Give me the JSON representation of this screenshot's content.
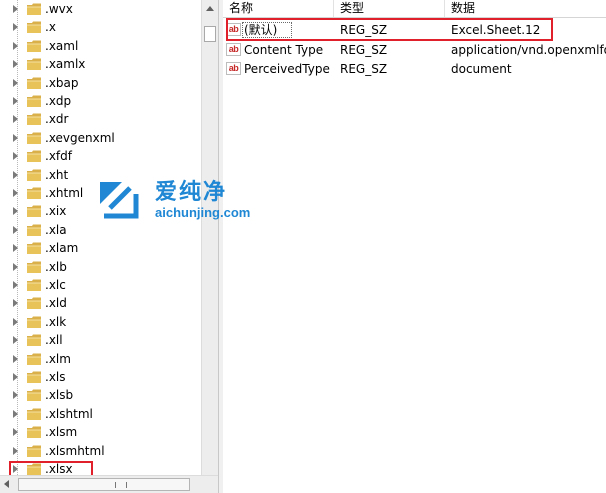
{
  "tree": {
    "items": [
      {
        "label": ".wvx"
      },
      {
        "label": ".x"
      },
      {
        "label": ".xaml"
      },
      {
        "label": ".xamlx"
      },
      {
        "label": ".xbap"
      },
      {
        "label": ".xdp"
      },
      {
        "label": ".xdr"
      },
      {
        "label": ".xevgenxml"
      },
      {
        "label": ".xfdf"
      },
      {
        "label": ".xht"
      },
      {
        "label": ".xhtml"
      },
      {
        "label": ".xix"
      },
      {
        "label": ".xla"
      },
      {
        "label": ".xlam"
      },
      {
        "label": ".xlb"
      },
      {
        "label": ".xlc"
      },
      {
        "label": ".xld"
      },
      {
        "label": ".xlk"
      },
      {
        "label": ".xll"
      },
      {
        "label": ".xlm"
      },
      {
        "label": ".xls"
      },
      {
        "label": ".xlsb"
      },
      {
        "label": ".xlshtml"
      },
      {
        "label": ".xlsm"
      },
      {
        "label": ".xlsmhtml"
      },
      {
        "label": ".xlsx"
      }
    ],
    "highlighted_item": ".xlsx"
  },
  "list": {
    "columns": {
      "name": "名称",
      "type": "类型",
      "data": "数据"
    },
    "rows": [
      {
        "icon": "ab",
        "name": "(默认)",
        "type": "REG_SZ",
        "data": "Excel.Sheet.12"
      },
      {
        "icon": "ab",
        "name": "Content Type",
        "type": "REG_SZ",
        "data": "application/vnd.openxmlform"
      },
      {
        "icon": "ab",
        "name": "PerceivedType",
        "type": "REG_SZ",
        "data": "document"
      }
    ]
  },
  "watermark": {
    "cn": "爱纯净",
    "en": "aichunjing.com"
  },
  "colors": {
    "highlight_border": "#e0202a",
    "folder_yellow": "#e8c35a",
    "watermark_blue": "#1f87d4",
    "value_icon_red": "#c62828"
  },
  "icons": {
    "tree_item": "folder-icon",
    "expander": "expand-arrow-icon",
    "value": "string-value-icon"
  }
}
